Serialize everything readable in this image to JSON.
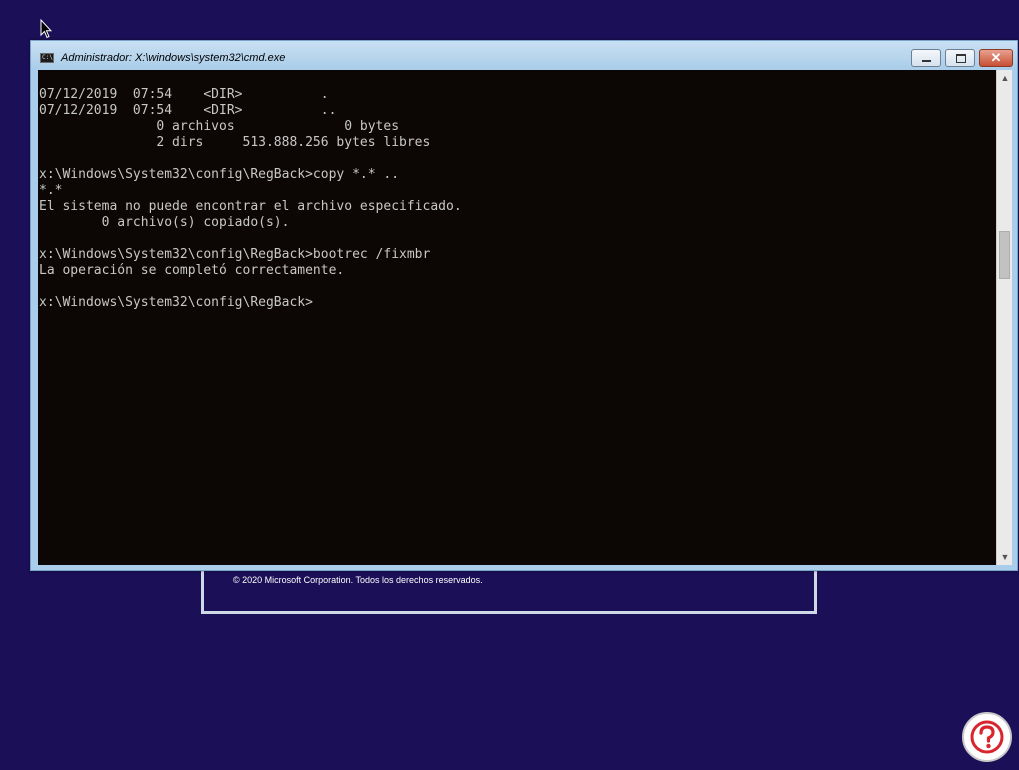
{
  "background": {
    "color": "#1b0f57"
  },
  "setup_dialog": {
    "copyright": "© 2020 Microsoft Corporation. Todos los derechos reservados."
  },
  "cmd_window": {
    "title": "Administrador: X:\\windows\\system32\\cmd.exe",
    "icon": "cmd-icon",
    "icon_text": "C:\\",
    "close_glyph": "✕",
    "scroll_up_glyph": "▲",
    "scroll_down_glyph": "▼",
    "console_lines": [
      "07/12/2019  07:54    <DIR>          .",
      "07/12/2019  07:54    <DIR>          ..",
      "               0 archivos              0 bytes",
      "               2 dirs     513.888.256 bytes libres",
      "",
      "x:\\Windows\\System32\\config\\RegBack>copy *.* ..",
      "*.*",
      "El sistema no puede encontrar el archivo especificado.",
      "        0 archivo(s) copiado(s).",
      "",
      "x:\\Windows\\System32\\config\\RegBack>bootrec /fixmbr",
      "La operación se completó correctamente.",
      "",
      "x:\\Windows\\System32\\config\\RegBack>"
    ],
    "scroll_position": 0.35
  },
  "watermark": {
    "icon": "help-person-logo",
    "color": "#d8262e"
  }
}
